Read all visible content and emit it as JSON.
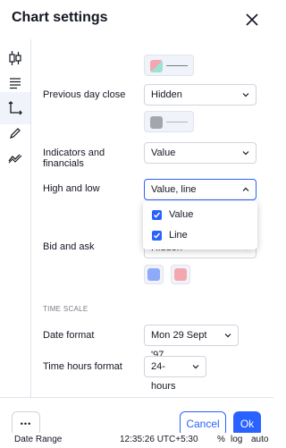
{
  "dialog": {
    "title": "Chart settings",
    "close_icon": "close-icon"
  },
  "sidebar": {
    "items": [
      {
        "name": "symbol",
        "icon": "candles-icon",
        "active": false
      },
      {
        "name": "status-line",
        "icon": "status-line-icon",
        "active": false
      },
      {
        "name": "scales",
        "icon": "scales-icon",
        "active": true
      },
      {
        "name": "appearance",
        "icon": "pencil-icon",
        "active": false
      },
      {
        "name": "trading",
        "icon": "trading-icon",
        "active": false
      }
    ]
  },
  "settings": {
    "previous_day_close": {
      "label": "Previous day close",
      "value": "Hidden"
    },
    "indicators": {
      "label_line1": "Indicators and",
      "label_line2": "financials",
      "value": "Value"
    },
    "high_low": {
      "label": "High and low",
      "value": "Value, line"
    },
    "bid_ask": {
      "label": "Bid and ask",
      "value": "Hidden"
    },
    "time_scale_title": "TIME SCALE",
    "date_format": {
      "label": "Date format",
      "value": "Mon 29 Sept '97"
    },
    "time_hours_format": {
      "label": "Time hours format",
      "value": "24-hours"
    }
  },
  "dropdown": {
    "options": [
      {
        "label": "Value",
        "checked": true
      },
      {
        "label": "Line",
        "checked": true
      }
    ]
  },
  "colors": {
    "accent": "#2962ff",
    "swatch_teal": "#9ee2d4",
    "swatch_pink": "#f4a7b0",
    "swatch_gray": "#a3a6af",
    "swatch_blue": "#8eaaf8",
    "swatch_pink2": "#f4a7b0"
  },
  "footer": {
    "more_label": "•••",
    "cancel_label": "Cancel",
    "ok_label": "Ok"
  },
  "background_strip": {
    "date_range": "Date Range",
    "time": "12:35:26 UTC+5:30",
    "percent": "%",
    "log": "log",
    "auto": "auto"
  }
}
